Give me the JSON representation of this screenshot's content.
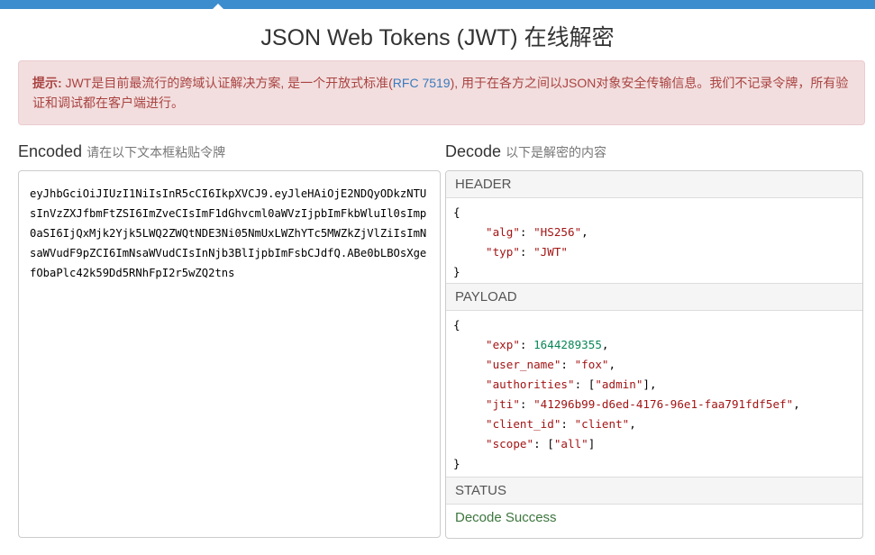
{
  "page": {
    "title": "JSON Web Tokens (JWT) 在线解密"
  },
  "notice": {
    "label": "提示:",
    "text_before": " JWT是目前最流行的跨域认证解决方案, 是一个开放式标准(",
    "link": "RFC 7519",
    "text_after": "), 用于在各方之间以JSON对象安全传输信息。我们不记录令牌，所有验证和调试都在客户端进行。"
  },
  "encoded": {
    "title": "Encoded",
    "subtitle": "请在以下文本框粘贴令牌",
    "token": "eyJhbGciOiJIUzI1NiIsInR5cCI6IkpXVCJ9.eyJleHAiOjE2NDQyODkzNTUsInVzZXJfbmFtZSI6ImZveCIsImF1dGhvcml0aWVzIjpbImFkbWluIl0sImp0aSI6IjQxMjk2Yjk5LWQ2ZWQtNDE3Ni05NmUxLWZhYTc5MWZkZjVlZiIsImNsaWVudF9pZCI6ImNsaWVudCIsInNjb3BlIjpbImFsbCJdfQ.ABe0bLBOsXgefObaPlc42k59Dd5RNhFpI2r5wZQ2tns"
  },
  "decode": {
    "title": "Decode",
    "subtitle": "以下是解密的内容",
    "header_label": "HEADER",
    "header": {
      "open": "{",
      "close": "}",
      "lines": [
        {
          "key": "\"alg\"",
          "sep": ": ",
          "val": "\"HS256\"",
          "tail": ","
        },
        {
          "key": "\"typ\"",
          "sep": ": ",
          "val": "\"JWT\"",
          "tail": ""
        }
      ]
    },
    "payload_label": "PAYLOAD",
    "payload": {
      "open": "{",
      "close": "}",
      "lines": [
        {
          "key": "\"exp\"",
          "sep": ": ",
          "val": "1644289355",
          "tail": ",",
          "type": "n"
        },
        {
          "key": "\"user_name\"",
          "sep": ": ",
          "val": "\"fox\"",
          "tail": ",",
          "type": "s"
        },
        {
          "key": "\"authorities\"",
          "sep": ": [",
          "val": "\"admin\"",
          "tail": "],",
          "type": "s"
        },
        {
          "key": "\"jti\"",
          "sep": ": ",
          "val": "\"41296b99-d6ed-4176-96e1-faa791fdf5ef\"",
          "tail": ",",
          "type": "s"
        },
        {
          "key": "\"client_id\"",
          "sep": ": ",
          "val": "\"client\"",
          "tail": ",",
          "type": "s"
        },
        {
          "key": "\"scope\"",
          "sep": ": [",
          "val": "\"all\"",
          "tail": "]",
          "type": "s"
        }
      ]
    },
    "status_label": "STATUS",
    "status_text": "Decode Success"
  }
}
